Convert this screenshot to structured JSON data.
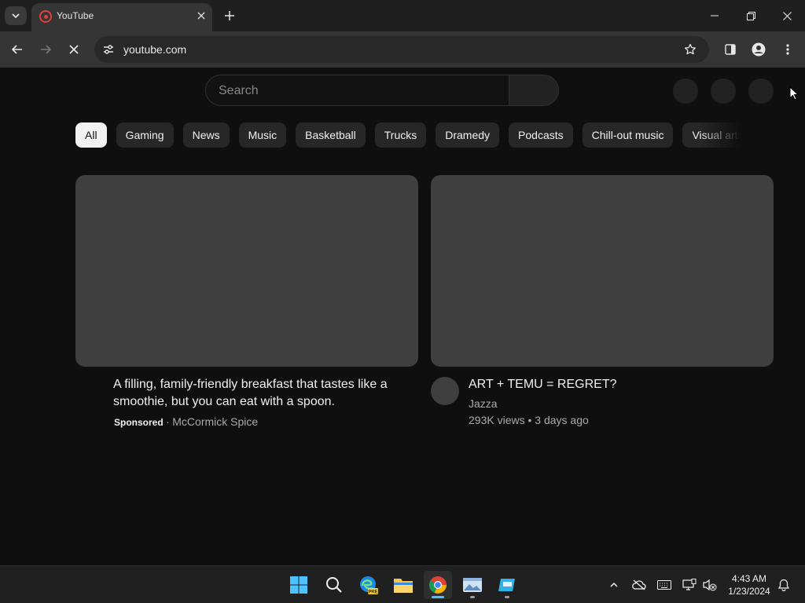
{
  "browser": {
    "tab": {
      "title": "YouTube"
    },
    "address_bar": {
      "url": "youtube.com"
    }
  },
  "youtube": {
    "search": {
      "placeholder": "Search"
    },
    "chips": [
      "All",
      "Gaming",
      "News",
      "Music",
      "Basketball",
      "Trucks",
      "Dramedy",
      "Podcasts",
      "Chill-out music",
      "Visual arts"
    ],
    "videos": [
      {
        "title_line1": "A filling, family-friendly breakfast that tastes like a",
        "title_line2": "smoothie, but you can eat with a spoon.",
        "badge": "Sponsored",
        "separator": "·",
        "channel": "McCormick Spice"
      },
      {
        "title": "ART + TEMU = REGRET?",
        "channel": "Jazza",
        "views": "293K views",
        "separator": "•",
        "age": "3 days ago"
      }
    ]
  },
  "taskbar": {
    "clock": {
      "time": "4:43 AM",
      "date": "1/23/2024"
    },
    "edge_badge": "PRE"
  },
  "colors": {
    "background": "#0f0f0f",
    "chrome_frame": "#1f1f1f",
    "toolbar": "#353535",
    "placeholder_thumb": "#3f3f3f",
    "chip": "#272727",
    "taskbar": "#202020",
    "windows_accent": "#4cc2ff"
  }
}
